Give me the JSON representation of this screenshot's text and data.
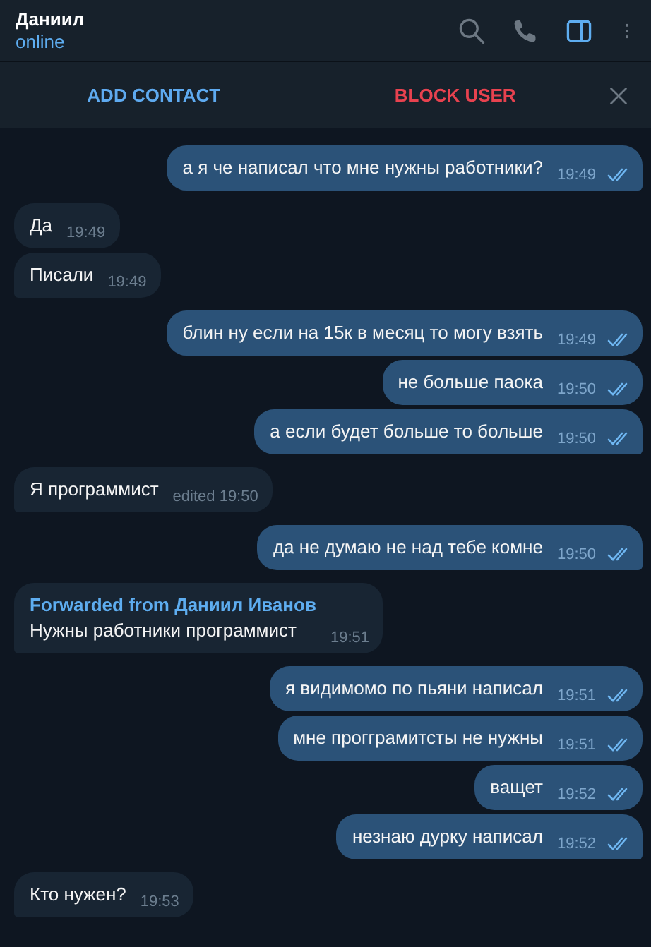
{
  "header": {
    "name": "Даниил",
    "status": "online",
    "icons": [
      {
        "kind": "search",
        "selected": false
      },
      {
        "kind": "phone",
        "selected": false
      },
      {
        "kind": "sidebar",
        "selected": true
      },
      {
        "kind": "more",
        "selected": false
      }
    ]
  },
  "action_bar": {
    "buttons": [
      {
        "label": "ADD CONTACT",
        "kind": "primary"
      },
      {
        "label": "BLOCK USER",
        "kind": "danger"
      }
    ],
    "close": true
  },
  "messages": [
    {
      "text": "а я че написал что мне нужны работники?",
      "time": "19:49",
      "outgoing": true,
      "read": true
    },
    {
      "text": "Да",
      "time": "19:49",
      "outgoing": false
    },
    {
      "text": "Писали",
      "time": "19:49",
      "outgoing": false
    },
    {
      "text": "блин ну если на 15к в месяц то могу взять",
      "time": "19:49",
      "outgoing": true,
      "read": true
    },
    {
      "text": "не больше паока",
      "time": "19:50",
      "outgoing": true,
      "read": true
    },
    {
      "text": "а если будет больше то больше",
      "time": "19:50",
      "outgoing": true,
      "read": true
    },
    {
      "text": "Я программист",
      "time": "19:50",
      "edited_label": "edited",
      "outgoing": false
    },
    {
      "text": "да не думаю не над тебе комне",
      "time": "19:50",
      "outgoing": true,
      "read": true
    },
    {
      "forwarded_from": "Forwarded from Даниил Иванов",
      "text": "Нужны работники программист",
      "time": "19:51",
      "outgoing": false
    },
    {
      "text": "я видимомо по пьяни написал",
      "time": "19:51",
      "outgoing": true,
      "read": true
    },
    {
      "text": "мне прогграмитсты не нужны",
      "time": "19:51",
      "outgoing": true,
      "read": true
    },
    {
      "text": "ващет",
      "time": "19:52",
      "outgoing": true,
      "read": true
    },
    {
      "text": "незнаю дурку написал",
      "time": "19:52",
      "outgoing": true,
      "read": true
    },
    {
      "text": "Кто нужен?",
      "time": "19:53",
      "outgoing": false
    }
  ]
}
